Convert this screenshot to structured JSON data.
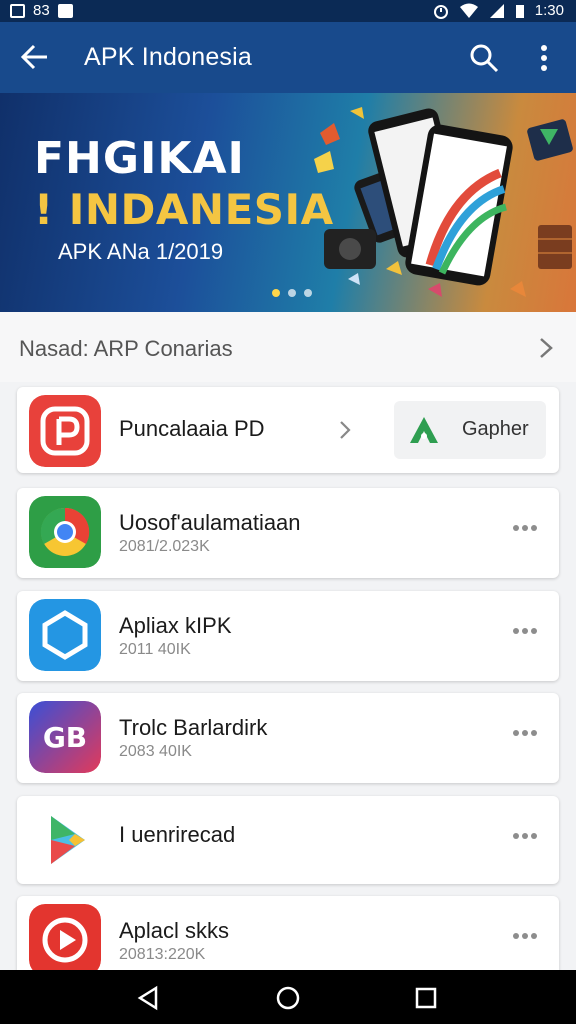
{
  "status_bar": {
    "left_text": "83",
    "time": "1:30"
  },
  "app_bar": {
    "title": "APK Indonesia"
  },
  "banner": {
    "line1": "FHGIKAI",
    "line2": "! INDANESIA",
    "line3": "APK ANa 1/2019",
    "slides": 3,
    "active_slide": 1
  },
  "section": {
    "title": "Nasad: ARP Conarias"
  },
  "featured": {
    "name": "Puncalaaia PD",
    "action_label": "Gapher"
  },
  "apps": [
    {
      "name": "Uosof'aulamatiaan",
      "meta": "2081/2.023K",
      "icon": "chrome-icon"
    },
    {
      "name": "Apliax kIPK",
      "meta": "2011 40IK",
      "icon": "hexagon-chat-icon"
    },
    {
      "name": "Trolc Barlardirk",
      "meta": "2083 40IK",
      "icon": "gb-icon"
    },
    {
      "name": "I uenrirecad",
      "meta": "",
      "icon": "play-store-icon"
    },
    {
      "name": "Aplacl skks",
      "meta": "20813:220K",
      "icon": "play-circle-icon"
    }
  ],
  "colors": {
    "status_bar": "#0b2a55",
    "app_bar": "#184a8c",
    "banner_title": "#ffffff",
    "banner_accent": "#f4c542"
  }
}
